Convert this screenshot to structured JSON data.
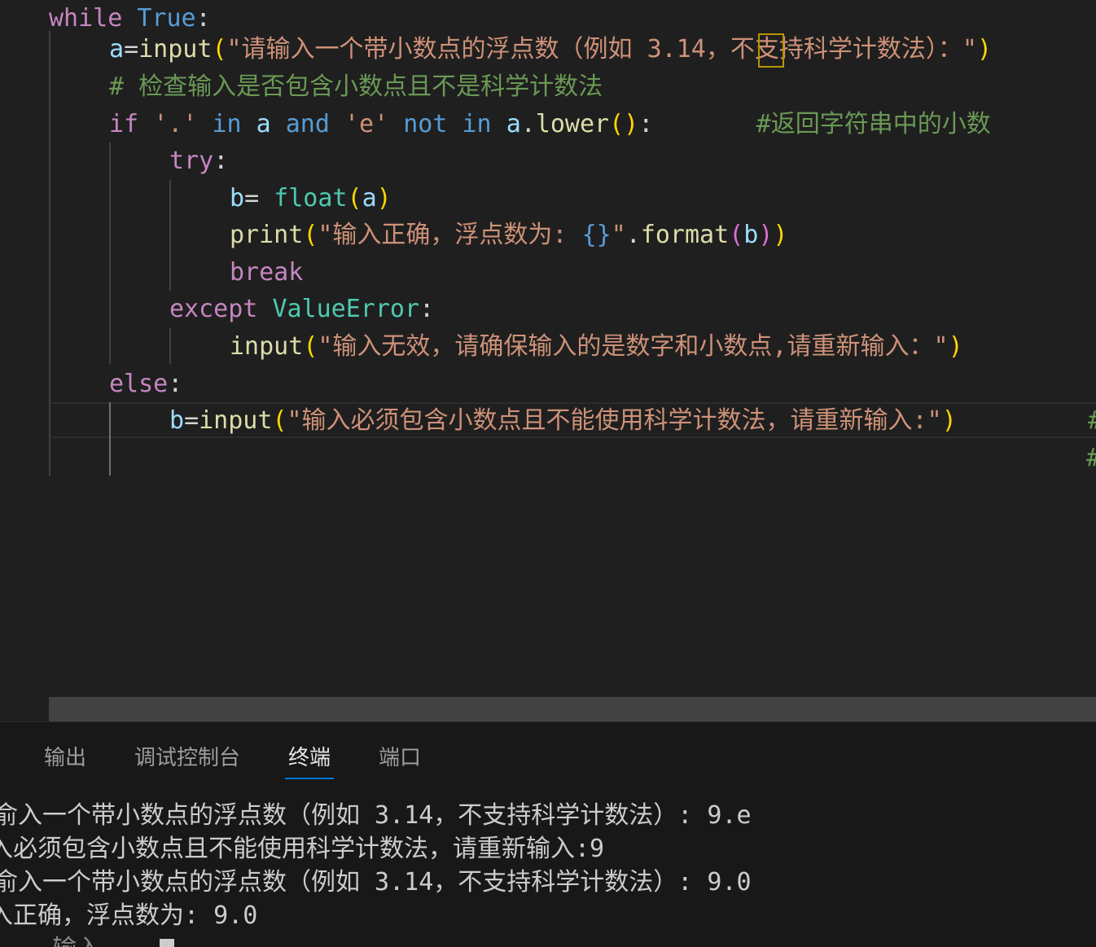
{
  "editor": {
    "lines": [
      [
        {
          "t": "while",
          "c": "kw"
        },
        {
          "t": " ",
          "c": "op"
        },
        {
          "t": "True",
          "c": "kwb"
        },
        {
          "t": ":",
          "c": "op"
        }
      ],
      [
        {
          "t": "a",
          "c": "var"
        },
        {
          "t": "=",
          "c": "op"
        },
        {
          "t": "input",
          "c": "fn"
        },
        {
          "t": "(",
          "c": "p1"
        },
        {
          "t": "\"请输入一个带小数点的浮点数（例如 3.14，不支持科学计数法）：\"",
          "c": "str"
        },
        {
          "t": ")",
          "c": "p1"
        }
      ],
      [
        {
          "t": "# 检查输入是否包含小数点且不是科学计数法",
          "c": "com"
        }
      ],
      [
        {
          "t": "if",
          "c": "kw"
        },
        {
          "t": " ",
          "c": "op"
        },
        {
          "t": "'.'",
          "c": "str"
        },
        {
          "t": " ",
          "c": "op"
        },
        {
          "t": "in",
          "c": "kwb"
        },
        {
          "t": " ",
          "c": "op"
        },
        {
          "t": "a",
          "c": "var"
        },
        {
          "t": " ",
          "c": "op"
        },
        {
          "t": "and",
          "c": "kwb"
        },
        {
          "t": " ",
          "c": "op"
        },
        {
          "t": "'e'",
          "c": "str"
        },
        {
          "t": " ",
          "c": "op"
        },
        {
          "t": "not",
          "c": "kwb"
        },
        {
          "t": " ",
          "c": "op"
        },
        {
          "t": "in",
          "c": "kwb"
        },
        {
          "t": " ",
          "c": "op"
        },
        {
          "t": "a",
          "c": "var"
        },
        {
          "t": ".",
          "c": "op"
        },
        {
          "t": "lower",
          "c": "fn"
        },
        {
          "t": "()",
          "c": "p1"
        },
        {
          "t": ":",
          "c": "op"
        },
        {
          "t": "       ",
          "c": "op"
        },
        {
          "t": "#返回字符串中的小数",
          "c": "com"
        }
      ],
      [
        {
          "t": "try",
          "c": "kw"
        },
        {
          "t": ":",
          "c": "op"
        }
      ],
      [
        {
          "t": "b",
          "c": "var"
        },
        {
          "t": "= ",
          "c": "op"
        },
        {
          "t": "float",
          "c": "cls"
        },
        {
          "t": "(",
          "c": "p1"
        },
        {
          "t": "a",
          "c": "var"
        },
        {
          "t": ")",
          "c": "p1"
        }
      ],
      [
        {
          "t": "print",
          "c": "fn"
        },
        {
          "t": "(",
          "c": "p1"
        },
        {
          "t": "\"输入正确，浮点数为: ",
          "c": "str"
        },
        {
          "t": "{}",
          "c": "kwb"
        },
        {
          "t": "\"",
          "c": "str"
        },
        {
          "t": ".",
          "c": "op"
        },
        {
          "t": "format",
          "c": "fn"
        },
        {
          "t": "(",
          "c": "p2"
        },
        {
          "t": "b",
          "c": "var"
        },
        {
          "t": ")",
          "c": "p2"
        },
        {
          "t": ")",
          "c": "p1"
        }
      ],
      [
        {
          "t": "break",
          "c": "kw"
        }
      ],
      [
        {
          "t": "except",
          "c": "kw"
        },
        {
          "t": " ",
          "c": "op"
        },
        {
          "t": "ValueError",
          "c": "cls"
        },
        {
          "t": ":",
          "c": "op"
        }
      ],
      [
        {
          "t": "input",
          "c": "fn"
        },
        {
          "t": "(",
          "c": "p1"
        },
        {
          "t": "\"输入无效，请确保输入的是数字和小数点,请重新输入：\"",
          "c": "str"
        },
        {
          "t": ")",
          "c": "p1"
        }
      ],
      [
        {
          "t": "else",
          "c": "kw"
        },
        {
          "t": ":",
          "c": "op"
        }
      ],
      [
        {
          "t": "b",
          "c": "var"
        },
        {
          "t": "=",
          "c": "op"
        },
        {
          "t": "input",
          "c": "fn"
        },
        {
          "t": "(",
          "c": "p1"
        },
        {
          "t": "\"输入必须包含小数点且不能使用科学计数法，请重新输入:\"",
          "c": "str"
        },
        {
          "t": ")",
          "c": "p1"
        }
      ]
    ],
    "edge_comments": [
      "#",
      "#"
    ]
  },
  "panel": {
    "tabs": [
      "输出",
      "调试控制台",
      "终端",
      "端口"
    ],
    "active_tab": "终端"
  },
  "terminal": {
    "lines": [
      "俞入一个带小数点的浮点数（例如 3.14，不支持科学计数法）: 9.e",
      "入必须包含小数点且不能使用科学计数法，请重新输入:9",
      "俞入一个带小数点的浮点数（例如 3.14，不支持科学计数法）: 9.0",
      "入正确，浮点数为: 9.0",
      "    输入"
    ]
  }
}
